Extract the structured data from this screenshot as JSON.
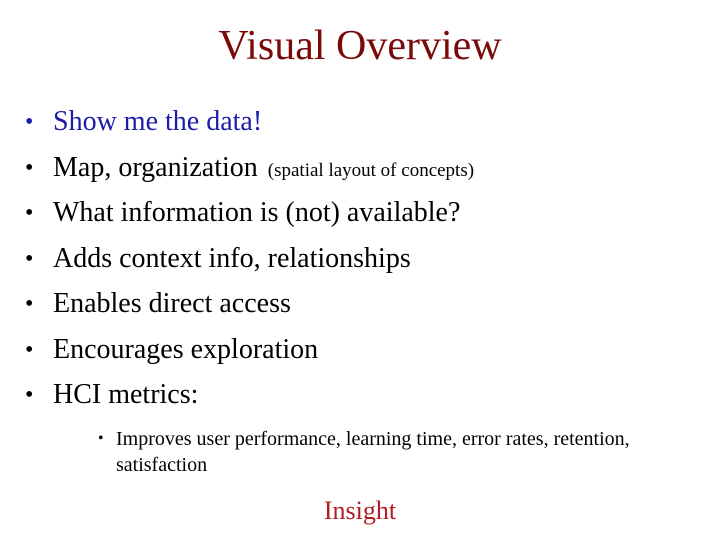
{
  "slide": {
    "title": "Visual Overview",
    "bullet_glyph": "•",
    "bullets": [
      {
        "text": "Show me the data!",
        "aside": ""
      },
      {
        "text": "Map, organization",
        "aside": "(spatial layout of concepts)"
      },
      {
        "text": "What information is (not) available?",
        "aside": ""
      },
      {
        "text": "Adds context info, relationships",
        "aside": ""
      },
      {
        "text": "Enables direct access",
        "aside": ""
      },
      {
        "text": "Encourages exploration",
        "aside": ""
      },
      {
        "text": "HCI metrics:",
        "aside": ""
      }
    ],
    "sub_bullets": [
      {
        "text": "Improves user performance, learning time, error rates, retention, satisfaction"
      }
    ],
    "footer": "Insight"
  },
  "colors": {
    "title": "#7a0a0a",
    "highlight_bullet": "#1c1ca8",
    "body_text": "#000000",
    "footer": "#b01c22",
    "background": "#ffffff"
  }
}
